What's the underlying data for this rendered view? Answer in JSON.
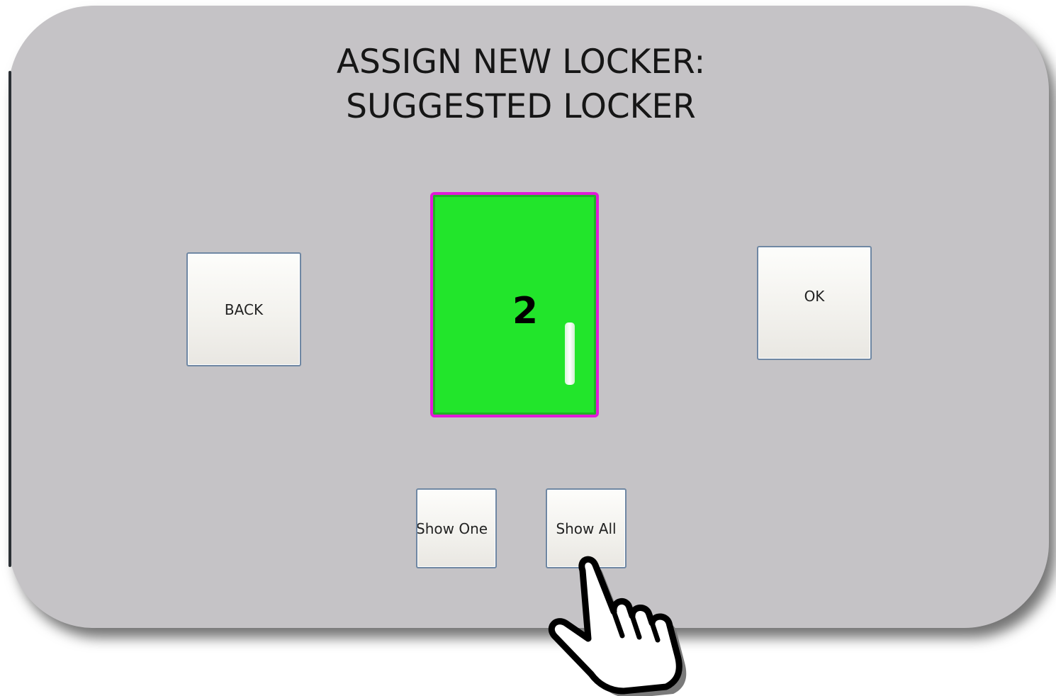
{
  "dialog": {
    "title_line1": "ASSIGN NEW LOCKER:",
    "title_line2": "SUGGESTED LOCKER"
  },
  "buttons": {
    "back_label": "BACK",
    "ok_label": "OK",
    "show_one_label": "Show One",
    "show_all_label": "Show All"
  },
  "locker": {
    "number": "2",
    "fill_color": "#22e52b",
    "border_color": "#e21ad9"
  },
  "cursor": {
    "icon": "pointing-hand-icon"
  },
  "colors": {
    "panel_background": "#c5c3c6",
    "button_border": "#6f87a3"
  }
}
